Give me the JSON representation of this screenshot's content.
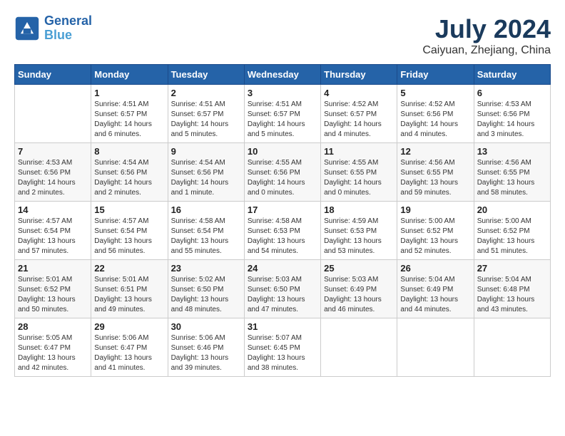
{
  "header": {
    "logo_line1": "General",
    "logo_line2": "Blue",
    "month_year": "July 2024",
    "location": "Caiyuan, Zhejiang, China"
  },
  "weekdays": [
    "Sunday",
    "Monday",
    "Tuesday",
    "Wednesday",
    "Thursday",
    "Friday",
    "Saturday"
  ],
  "weeks": [
    [
      {
        "day": "",
        "sunrise": "",
        "sunset": "",
        "daylight": ""
      },
      {
        "day": "1",
        "sunrise": "Sunrise: 4:51 AM",
        "sunset": "Sunset: 6:57 PM",
        "daylight": "Daylight: 14 hours and 6 minutes."
      },
      {
        "day": "2",
        "sunrise": "Sunrise: 4:51 AM",
        "sunset": "Sunset: 6:57 PM",
        "daylight": "Daylight: 14 hours and 5 minutes."
      },
      {
        "day": "3",
        "sunrise": "Sunrise: 4:51 AM",
        "sunset": "Sunset: 6:57 PM",
        "daylight": "Daylight: 14 hours and 5 minutes."
      },
      {
        "day": "4",
        "sunrise": "Sunrise: 4:52 AM",
        "sunset": "Sunset: 6:57 PM",
        "daylight": "Daylight: 14 hours and 4 minutes."
      },
      {
        "day": "5",
        "sunrise": "Sunrise: 4:52 AM",
        "sunset": "Sunset: 6:56 PM",
        "daylight": "Daylight: 14 hours and 4 minutes."
      },
      {
        "day": "6",
        "sunrise": "Sunrise: 4:53 AM",
        "sunset": "Sunset: 6:56 PM",
        "daylight": "Daylight: 14 hours and 3 minutes."
      }
    ],
    [
      {
        "day": "7",
        "sunrise": "Sunrise: 4:53 AM",
        "sunset": "Sunset: 6:56 PM",
        "daylight": "Daylight: 14 hours and 2 minutes."
      },
      {
        "day": "8",
        "sunrise": "Sunrise: 4:54 AM",
        "sunset": "Sunset: 6:56 PM",
        "daylight": "Daylight: 14 hours and 2 minutes."
      },
      {
        "day": "9",
        "sunrise": "Sunrise: 4:54 AM",
        "sunset": "Sunset: 6:56 PM",
        "daylight": "Daylight: 14 hours and 1 minute."
      },
      {
        "day": "10",
        "sunrise": "Sunrise: 4:55 AM",
        "sunset": "Sunset: 6:56 PM",
        "daylight": "Daylight: 14 hours and 0 minutes."
      },
      {
        "day": "11",
        "sunrise": "Sunrise: 4:55 AM",
        "sunset": "Sunset: 6:55 PM",
        "daylight": "Daylight: 14 hours and 0 minutes."
      },
      {
        "day": "12",
        "sunrise": "Sunrise: 4:56 AM",
        "sunset": "Sunset: 6:55 PM",
        "daylight": "Daylight: 13 hours and 59 minutes."
      },
      {
        "day": "13",
        "sunrise": "Sunrise: 4:56 AM",
        "sunset": "Sunset: 6:55 PM",
        "daylight": "Daylight: 13 hours and 58 minutes."
      }
    ],
    [
      {
        "day": "14",
        "sunrise": "Sunrise: 4:57 AM",
        "sunset": "Sunset: 6:54 PM",
        "daylight": "Daylight: 13 hours and 57 minutes."
      },
      {
        "day": "15",
        "sunrise": "Sunrise: 4:57 AM",
        "sunset": "Sunset: 6:54 PM",
        "daylight": "Daylight: 13 hours and 56 minutes."
      },
      {
        "day": "16",
        "sunrise": "Sunrise: 4:58 AM",
        "sunset": "Sunset: 6:54 PM",
        "daylight": "Daylight: 13 hours and 55 minutes."
      },
      {
        "day": "17",
        "sunrise": "Sunrise: 4:58 AM",
        "sunset": "Sunset: 6:53 PM",
        "daylight": "Daylight: 13 hours and 54 minutes."
      },
      {
        "day": "18",
        "sunrise": "Sunrise: 4:59 AM",
        "sunset": "Sunset: 6:53 PM",
        "daylight": "Daylight: 13 hours and 53 minutes."
      },
      {
        "day": "19",
        "sunrise": "Sunrise: 5:00 AM",
        "sunset": "Sunset: 6:52 PM",
        "daylight": "Daylight: 13 hours and 52 minutes."
      },
      {
        "day": "20",
        "sunrise": "Sunrise: 5:00 AM",
        "sunset": "Sunset: 6:52 PM",
        "daylight": "Daylight: 13 hours and 51 minutes."
      }
    ],
    [
      {
        "day": "21",
        "sunrise": "Sunrise: 5:01 AM",
        "sunset": "Sunset: 6:52 PM",
        "daylight": "Daylight: 13 hours and 50 minutes."
      },
      {
        "day": "22",
        "sunrise": "Sunrise: 5:01 AM",
        "sunset": "Sunset: 6:51 PM",
        "daylight": "Daylight: 13 hours and 49 minutes."
      },
      {
        "day": "23",
        "sunrise": "Sunrise: 5:02 AM",
        "sunset": "Sunset: 6:50 PM",
        "daylight": "Daylight: 13 hours and 48 minutes."
      },
      {
        "day": "24",
        "sunrise": "Sunrise: 5:03 AM",
        "sunset": "Sunset: 6:50 PM",
        "daylight": "Daylight: 13 hours and 47 minutes."
      },
      {
        "day": "25",
        "sunrise": "Sunrise: 5:03 AM",
        "sunset": "Sunset: 6:49 PM",
        "daylight": "Daylight: 13 hours and 46 minutes."
      },
      {
        "day": "26",
        "sunrise": "Sunrise: 5:04 AM",
        "sunset": "Sunset: 6:49 PM",
        "daylight": "Daylight: 13 hours and 44 minutes."
      },
      {
        "day": "27",
        "sunrise": "Sunrise: 5:04 AM",
        "sunset": "Sunset: 6:48 PM",
        "daylight": "Daylight: 13 hours and 43 minutes."
      }
    ],
    [
      {
        "day": "28",
        "sunrise": "Sunrise: 5:05 AM",
        "sunset": "Sunset: 6:47 PM",
        "daylight": "Daylight: 13 hours and 42 minutes."
      },
      {
        "day": "29",
        "sunrise": "Sunrise: 5:06 AM",
        "sunset": "Sunset: 6:47 PM",
        "daylight": "Daylight: 13 hours and 41 minutes."
      },
      {
        "day": "30",
        "sunrise": "Sunrise: 5:06 AM",
        "sunset": "Sunset: 6:46 PM",
        "daylight": "Daylight: 13 hours and 39 minutes."
      },
      {
        "day": "31",
        "sunrise": "Sunrise: 5:07 AM",
        "sunset": "Sunset: 6:45 PM",
        "daylight": "Daylight: 13 hours and 38 minutes."
      },
      {
        "day": "",
        "sunrise": "",
        "sunset": "",
        "daylight": ""
      },
      {
        "day": "",
        "sunrise": "",
        "sunset": "",
        "daylight": ""
      },
      {
        "day": "",
        "sunrise": "",
        "sunset": "",
        "daylight": ""
      }
    ]
  ]
}
